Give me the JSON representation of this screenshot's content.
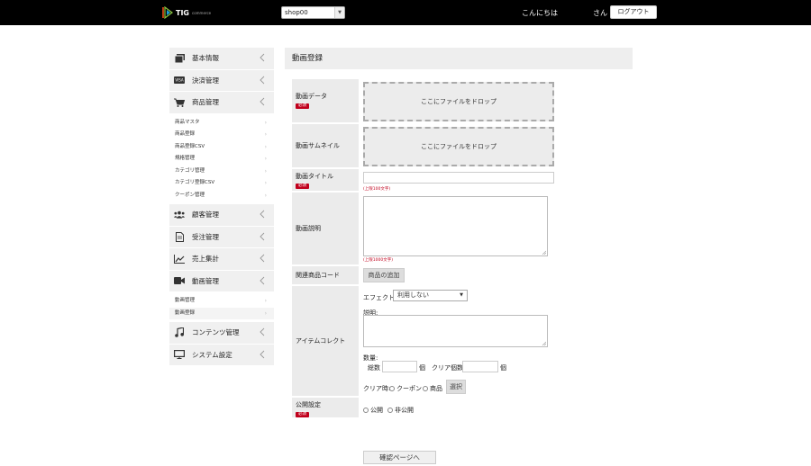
{
  "header": {
    "logo_text": "TIG",
    "logo_sub": "commerce",
    "shop_select_value": "shop00",
    "greeting": "こんにちは",
    "honorific": "さん",
    "logout_label": "ログアウト"
  },
  "sidebar": {
    "items": [
      {
        "label": "基本情報",
        "icon": "info-card-icon"
      },
      {
        "label": "決済管理",
        "icon": "visa-card-icon"
      },
      {
        "label": "商品管理",
        "icon": "shopping-cart-icon"
      },
      {
        "label": "顧客管理",
        "icon": "users-icon"
      },
      {
        "label": "受注管理",
        "icon": "document-icon"
      },
      {
        "label": "売上集計",
        "icon": "line-chart-icon"
      },
      {
        "label": "動画管理",
        "icon": "video-camera-icon"
      },
      {
        "label": "コンテンツ管理",
        "icon": "music-note-icon"
      },
      {
        "label": "システム設定",
        "icon": "monitor-icon"
      }
    ],
    "product_sub": [
      "商品マスタ",
      "商品登録",
      "商品登録CSV",
      "規格管理",
      "カテゴリ管理",
      "カテゴリ登録CSV",
      "クーポン管理"
    ],
    "video_sub": [
      "動画管理",
      "動画登録"
    ]
  },
  "main": {
    "title": "動画登録",
    "required_badge": "必須",
    "video_data_label": "動画データ",
    "drop_text": "ここにファイルをドロップ",
    "thumbnail_label": "動画サムネイル",
    "title_label": "動画タイトル",
    "title_hint": "(上限100文字)",
    "desc_label": "動画説明",
    "desc_hint": "(上限1000文字)",
    "related_label": "関連商品コード",
    "add_product_button": "商品の追加",
    "item_collect_label": "アイテムコレクト",
    "effect_label": "エフェクト:",
    "effect_value": "利用しない",
    "explain_label": "説明:",
    "quantity_label": "数量:",
    "total_label": "総数",
    "unit": "個",
    "clear_count_label": "クリア個数",
    "clear_time_label": "クリア時:",
    "coupon_option": "クーポン",
    "product_option": "商品",
    "select_button": "選択",
    "publish_label": "公開設定",
    "public_option": "公開",
    "private_option": "非公開",
    "confirm_button": "確認ページへ"
  }
}
